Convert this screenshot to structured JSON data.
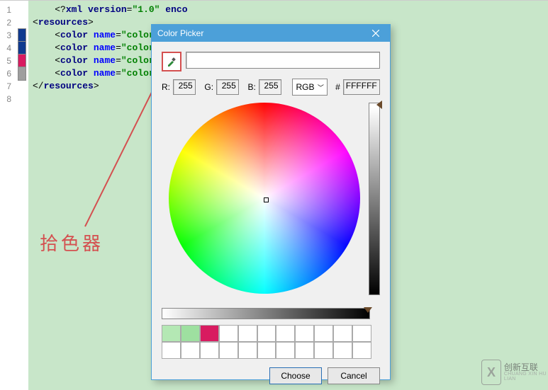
{
  "editor": {
    "line_numbers": [
      "1",
      "2",
      "3",
      "4",
      "5",
      "6",
      "7",
      "8"
    ],
    "markers": [
      {
        "color": null
      },
      {
        "color": null
      },
      {
        "color": "#103a8f"
      },
      {
        "color": "#103a8f"
      },
      {
        "color": "#d81b60"
      },
      {
        "color": "#9e9e9e"
      },
      {
        "color": null
      },
      {
        "color": null
      }
    ],
    "lines": [
      {
        "indent": 1,
        "html": "<span class='plain'>&lt;?</span><span class='tag'>xml version</span><span class='plain'>=</span><span class='str'>\"1.0\"</span> <span class='tag'>enco</span>"
      },
      {
        "indent": 0,
        "html": "<span class='plain'>&lt;</span><span class='tag'>resources</span><span class='plain'>&gt;</span>"
      },
      {
        "indent": 1,
        "html": "<span class='plain'>&lt;</span><span class='tag'>color </span><span class='attr'>name</span><span class='plain'>=</span><span class='str'>\"colorPrim</span>"
      },
      {
        "indent": 1,
        "html": "<span class='plain'>&lt;</span><span class='tag'>color </span><span class='attr'>name</span><span class='plain'>=</span><span class='str'>\"colorPrim</span>"
      },
      {
        "indent": 1,
        "html": "<span class='plain'>&lt;</span><span class='tag'>color </span><span class='attr'>name</span><span class='plain'>=</span><span class='str'>\"colorAcc</span>"
      },
      {
        "indent": 1,
        "html": "<span class='plain'>&lt;</span><span class='tag'>color </span><span class='attr'>name</span><span class='plain'>=</span><span class='str'>\"colorAcc</span>"
      },
      {
        "indent": 0,
        "html": "<span class='plain'>&lt;/</span><span class='tag'>resources</span><span class='plain'>&gt;</span>"
      },
      {
        "indent": 0,
        "html": ""
      }
    ]
  },
  "annotation": {
    "label": "拾色器"
  },
  "dialog": {
    "title": "Color Picker",
    "r_label": "R:",
    "g_label": "G:",
    "b_label": "B:",
    "r_value": "255",
    "g_value": "255",
    "b_value": "255",
    "mode": "RGB",
    "hex_prefix": "#",
    "hex_value": "FFFFFF",
    "swatch_colors": [
      "#b4e8b4",
      "#9ee0a0",
      "#d81b60",
      "#ffffff",
      "#ffffff",
      "#ffffff",
      "#ffffff",
      "#ffffff",
      "#ffffff",
      "#ffffff",
      "#ffffff",
      "#ffffff",
      "#ffffff",
      "#ffffff",
      "#ffffff",
      "#ffffff",
      "#ffffff",
      "#ffffff",
      "#ffffff",
      "#ffffff",
      "#ffffff",
      "#ffffff"
    ],
    "choose_label": "Choose",
    "cancel_label": "Cancel"
  },
  "watermark": {
    "logo_letter": "X",
    "text": "创新互联",
    "sub": "CHUANG XIN HU LIAN"
  }
}
